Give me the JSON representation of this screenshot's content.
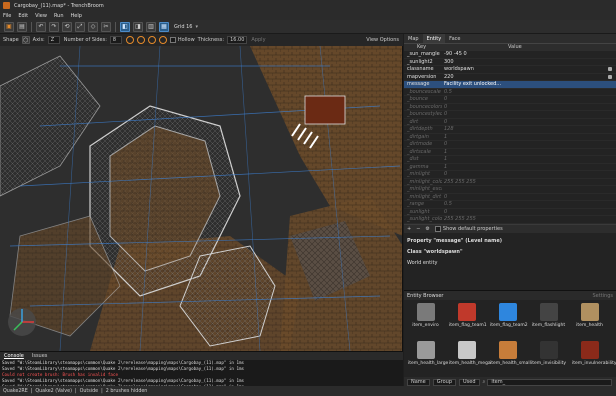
{
  "window": {
    "title": "Cargobay_(11).map* - TrenchBroom"
  },
  "menu": [
    "File",
    "Edit",
    "View",
    "Run",
    "Help"
  ],
  "toolbar": {
    "grid_label": "Grid 16"
  },
  "shapebar": {
    "shape_label": "Shape",
    "axis_label": "Axis:",
    "axis_value": "Z",
    "sides_label": "Number of Sides:",
    "sides_value": "8",
    "hollow_label": "Hollow",
    "thickness_label": "Thickness:",
    "thickness_value": "16.00",
    "apply_label": "Apply",
    "view_options": "View Options"
  },
  "inspector": {
    "tabs": [
      "Map",
      "Entity",
      "Face"
    ],
    "active_tab": "Entity",
    "key_header": "Key",
    "value_header": "Value",
    "rows": [
      {
        "k": "_sun_mangle",
        "v": "-90 -45 0",
        "dim": false,
        "lock": false
      },
      {
        "k": "_sunlight2",
        "v": "300",
        "dim": false,
        "lock": false
      },
      {
        "k": "classname",
        "v": "worldspawn",
        "dim": false,
        "lock": true
      },
      {
        "k": "mapversion",
        "v": "220",
        "dim": false,
        "lock": true
      },
      {
        "k": "message",
        "v": "Facility exit unlocked...",
        "dim": false,
        "lock": false,
        "sel": true
      },
      {
        "k": "_bouncescale",
        "v": "0.5",
        "dim": true
      },
      {
        "k": "_bounce",
        "v": "0",
        "dim": true
      },
      {
        "k": "_bouncecolorscale",
        "v": "0",
        "dim": true
      },
      {
        "k": "_bouncestyled",
        "v": "0",
        "dim": true
      },
      {
        "k": "_dirt",
        "v": "0",
        "dim": true
      },
      {
        "k": "_dirtdepth",
        "v": "128",
        "dim": true
      },
      {
        "k": "_dirtgain",
        "v": "1",
        "dim": true
      },
      {
        "k": "_dirtmode",
        "v": "0",
        "dim": true
      },
      {
        "k": "_dirtscale",
        "v": "1",
        "dim": true
      },
      {
        "k": "_dist",
        "v": "1",
        "dim": true
      },
      {
        "k": "_gamma",
        "v": "1",
        "dim": true
      },
      {
        "k": "_minlight",
        "v": "0",
        "dim": true
      },
      {
        "k": "_minlight_color",
        "v": "255 255 255",
        "dim": true
      },
      {
        "k": "_minlight_exclude",
        "v": "",
        "dim": true
      },
      {
        "k": "_minlight_dirt",
        "v": "0",
        "dim": true
      },
      {
        "k": "_range",
        "v": "0.5",
        "dim": true
      },
      {
        "k": "_sunlight",
        "v": "0",
        "dim": true
      },
      {
        "k": "_sunlight_color",
        "v": "255 255 255",
        "dim": true
      }
    ],
    "show_default_label": "Show default properties",
    "doc": {
      "property_line": "Property \"message\" (Level name)",
      "class_line": "Class \"worldspawn\"",
      "desc_line": "World entity"
    }
  },
  "entity_browser": {
    "title": "Entity Browser",
    "settings_label": "Settings",
    "items": [
      {
        "label": "item_enviro",
        "icon": "enviro-suit-icon",
        "color": "#7a7a7a"
      },
      {
        "label": "item_flag_team1",
        "icon": "red-flag-icon",
        "color": "#c0392b"
      },
      {
        "label": "item_flag_team2",
        "icon": "blue-flag-icon",
        "color": "#2e86de"
      },
      {
        "label": "item_flashlight",
        "icon": "flashlight-icon",
        "color": "#444"
      },
      {
        "label": "item_health",
        "icon": "health-box-icon",
        "color": "#b09060"
      },
      {
        "label": "item_health_large",
        "icon": "health-large-icon",
        "color": "#9a9a9a"
      },
      {
        "label": "item_health_mega",
        "icon": "health-mega-icon",
        "color": "#c8c8c8"
      },
      {
        "label": "item_health_small",
        "icon": "health-small-icon",
        "color": "#c77d3a"
      },
      {
        "label": "item_invisibility",
        "icon": "invisibility-icon",
        "color": "#333"
      },
      {
        "label": "item_invulnerability",
        "icon": "invulnerability-icon",
        "color": "#8a2a1a"
      }
    ],
    "footer": {
      "sort_label": "Name",
      "group_label": "Group",
      "used_label": "Used",
      "search_value": "item_"
    }
  },
  "console": {
    "tabs": [
      "Console",
      "Issues"
    ],
    "lines": [
      {
        "text": "Saved \"W:\\SteamLibrary\\steamapps\\common\\Quake 2\\rerelease\\mapping\\maps\\Cargobay_(11).map\" in 1ms",
        "err": false
      },
      {
        "text": "Saved \"W:\\SteamLibrary\\steamapps\\common\\Quake 2\\rerelease\\mapping\\maps\\Cargobay_(11).map\" in 1ms",
        "err": false
      },
      {
        "text": "Could not create brush: Brush has invalid face",
        "err": true
      },
      {
        "text": "Saved \"W:\\SteamLibrary\\steamapps\\common\\Quake 2\\rerelease\\mapping\\maps\\Cargobay_(11).map\" in 1ms",
        "err": false
      },
      {
        "text": "Saved \"W:\\SteamLibrary\\steamapps\\common\\Quake 2\\rerelease\\mapping\\maps\\Cargobay_(11).map\" in 1ms",
        "err": false
      }
    ]
  },
  "statusbar": [
    "Quake2RE",
    "Quake2 (Valve)",
    "Outside",
    "2 brushes hidden"
  ]
}
